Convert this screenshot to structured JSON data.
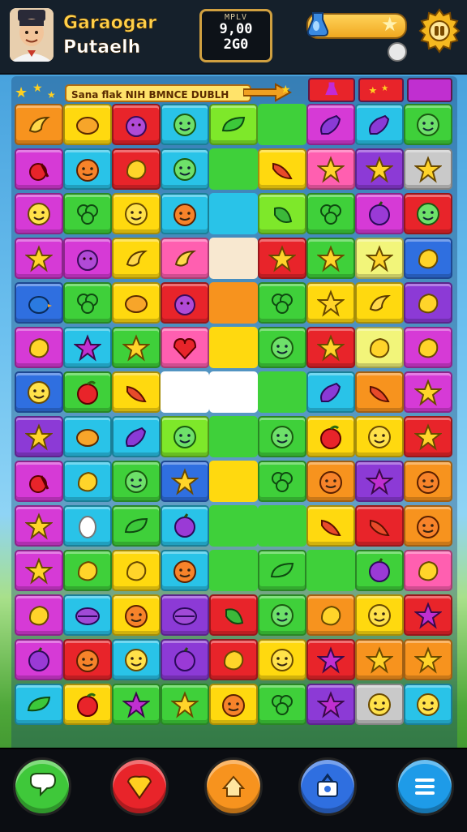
{
  "player": {
    "name_line1": "Garaogar",
    "name_line2": "Putaelh"
  },
  "score": {
    "label": "MPLV",
    "line1": "9,00",
    "line2": "2G0"
  },
  "level": {
    "banner_text": "Sana flak NIH BMNCE DUBLH"
  },
  "boosters": [
    {
      "name": "potion",
      "color": "#e8242a"
    },
    {
      "name": "star-pack",
      "color": "#e8242a"
    },
    {
      "name": "magic-slot",
      "color": "#c02fd0"
    }
  ],
  "colors": {
    "orange": "#f7931e",
    "yellow": "#ffd90f",
    "red": "#e8242a",
    "cyan": "#29c3e8",
    "green": "#3fd03a",
    "lime": "#7ee82a",
    "magenta": "#d63ad6",
    "purple": "#8c3ad6",
    "pink": "#ff5fb0",
    "blue": "#2f6fe0",
    "gray": "#c9c9c9",
    "paleyellow": "#f2f57a",
    "white": "#ffffff",
    "cream": "#f8e8d0"
  },
  "grid": {
    "rows": [
      [
        [
          "orange",
          "banana"
        ],
        [
          "yellow",
          "mango"
        ],
        [
          "red",
          "grape"
        ],
        [
          "cyan",
          "lime-face"
        ],
        [
          "lime",
          "leaf"
        ],
        [
          "green",
          ""
        ],
        [
          "magenta",
          "eggplant"
        ],
        [
          "cyan",
          "eggplant"
        ],
        [
          "green",
          "lime-face"
        ]
      ],
      [
        [
          "magenta",
          "cherry"
        ],
        [
          "cyan",
          "orange-face"
        ],
        [
          "red",
          "lemon"
        ],
        [
          "cyan",
          "lime-face"
        ],
        [
          "green",
          ""
        ],
        [
          "yellow",
          "chili"
        ],
        [
          "pink",
          "star"
        ],
        [
          "purple",
          "star"
        ],
        [
          "gray",
          "star"
        ]
      ],
      [
        [
          "magenta",
          "lemon-face"
        ],
        [
          "green",
          "clover"
        ],
        [
          "yellow",
          "lemon-face"
        ],
        [
          "cyan",
          "orange-face"
        ],
        [
          "cyan",
          ""
        ],
        [
          "lime",
          "pepper"
        ],
        [
          "green",
          "clover"
        ],
        [
          "magenta",
          "plum"
        ],
        [
          "red",
          "lime-face"
        ]
      ],
      [
        [
          "magenta",
          "star"
        ],
        [
          "magenta",
          "grape"
        ],
        [
          "yellow",
          "banana"
        ],
        [
          "pink",
          "banana"
        ],
        [
          "cream",
          ""
        ],
        [
          "red",
          "star"
        ],
        [
          "green",
          "star"
        ],
        [
          "paleyellow",
          "star"
        ],
        [
          "blue",
          "lemon"
        ]
      ],
      [
        [
          "blue",
          "bird"
        ],
        [
          "green",
          "clover"
        ],
        [
          "yellow",
          "mango"
        ],
        [
          "red",
          "grape"
        ],
        [
          "orange",
          ""
        ],
        [
          "green",
          "clover"
        ],
        [
          "yellow",
          "star"
        ],
        [
          "yellow",
          "banana"
        ],
        [
          "purple",
          "lemon"
        ]
      ],
      [
        [
          "magenta",
          "lemon"
        ],
        [
          "cyan",
          "starfish"
        ],
        [
          "green",
          "star"
        ],
        [
          "pink",
          "heart-face"
        ],
        [
          "yellow",
          ""
        ],
        [
          "green",
          "lime-face"
        ],
        [
          "red",
          "star"
        ],
        [
          "paleyellow",
          "lemon"
        ],
        [
          "magenta",
          "lemon"
        ]
      ],
      [
        [
          "blue",
          "lemon-face"
        ],
        [
          "green",
          "apple"
        ],
        [
          "yellow",
          "chili"
        ],
        [
          "white",
          ""
        ],
        [
          "white",
          ""
        ],
        [
          "green",
          ""
        ],
        [
          "cyan",
          "eggplant"
        ],
        [
          "orange",
          "chili"
        ],
        [
          "magenta",
          "star"
        ]
      ],
      [
        [
          "purple",
          "star"
        ],
        [
          "cyan",
          "mango"
        ],
        [
          "cyan",
          "eggplant"
        ],
        [
          "lime",
          "lime-face"
        ],
        [
          "green",
          ""
        ],
        [
          "green",
          "lime-face"
        ],
        [
          "yellow",
          "apple"
        ],
        [
          "yellow",
          "lemon-face"
        ],
        [
          "red",
          "star"
        ]
      ],
      [
        [
          "magenta",
          "cherry"
        ],
        [
          "cyan",
          "lemon"
        ],
        [
          "green",
          "lime-face"
        ],
        [
          "blue",
          "star"
        ],
        [
          "yellow",
          ""
        ],
        [
          "green",
          "clover"
        ],
        [
          "orange",
          "orange-face"
        ],
        [
          "purple",
          "starfish"
        ],
        [
          "orange",
          "orange-face"
        ]
      ],
      [
        [
          "magenta",
          "star"
        ],
        [
          "cyan",
          "egg"
        ],
        [
          "green",
          "leaf"
        ],
        [
          "cyan",
          "plum"
        ],
        [
          "green",
          ""
        ],
        [
          "green",
          ""
        ],
        [
          "yellow",
          "chili"
        ],
        [
          "red",
          "chili"
        ],
        [
          "orange",
          "orange-face"
        ]
      ],
      [
        [
          "magenta",
          "star"
        ],
        [
          "green",
          "lemon"
        ],
        [
          "yellow",
          "lemon"
        ],
        [
          "cyan",
          "orange-face"
        ],
        [
          "green",
          ""
        ],
        [
          "green",
          "leaf"
        ],
        [
          "green",
          ""
        ],
        [
          "green",
          "plum"
        ],
        [
          "pink",
          "lemon"
        ]
      ],
      [
        [
          "magenta",
          "lemon"
        ],
        [
          "cyan",
          "berry"
        ],
        [
          "yellow",
          "orange-face"
        ],
        [
          "purple",
          "berry"
        ],
        [
          "red",
          "pepper"
        ],
        [
          "green",
          "lime-face"
        ],
        [
          "orange",
          "lemon"
        ],
        [
          "yellow",
          "lemon-face"
        ],
        [
          "red",
          "starfish"
        ]
      ],
      [
        [
          "magenta",
          "plum"
        ],
        [
          "red",
          "orange-face"
        ],
        [
          "cyan",
          "lemon-face"
        ],
        [
          "purple",
          "plum"
        ],
        [
          "red",
          "lemon"
        ],
        [
          "yellow",
          "lemon-face"
        ],
        [
          "red",
          "starfish"
        ],
        [
          "orange",
          "star"
        ],
        [
          "orange",
          "star"
        ]
      ],
      [
        [
          "cyan",
          "leaf"
        ],
        [
          "yellow",
          "apple"
        ],
        [
          "green",
          "starfish"
        ],
        [
          "green",
          "star"
        ],
        [
          "yellow",
          "orange-face"
        ],
        [
          "green",
          "clover"
        ],
        [
          "purple",
          "starfish"
        ],
        [
          "gray",
          "lemon-face"
        ],
        [
          "cyan",
          "lemon-face"
        ]
      ]
    ]
  },
  "nav": [
    {
      "name": "chat-button",
      "color": "#3fc83a",
      "icon": "chat-icon"
    },
    {
      "name": "shield-button",
      "color": "#e8242a",
      "icon": "shield-icon"
    },
    {
      "name": "home-button",
      "color": "#f7931e",
      "icon": "home-icon"
    },
    {
      "name": "shop-button",
      "color": "#2f6fe0",
      "icon": "shop-icon"
    },
    {
      "name": "menu-button",
      "color": "#1e9be8",
      "icon": "menu-icon"
    }
  ]
}
